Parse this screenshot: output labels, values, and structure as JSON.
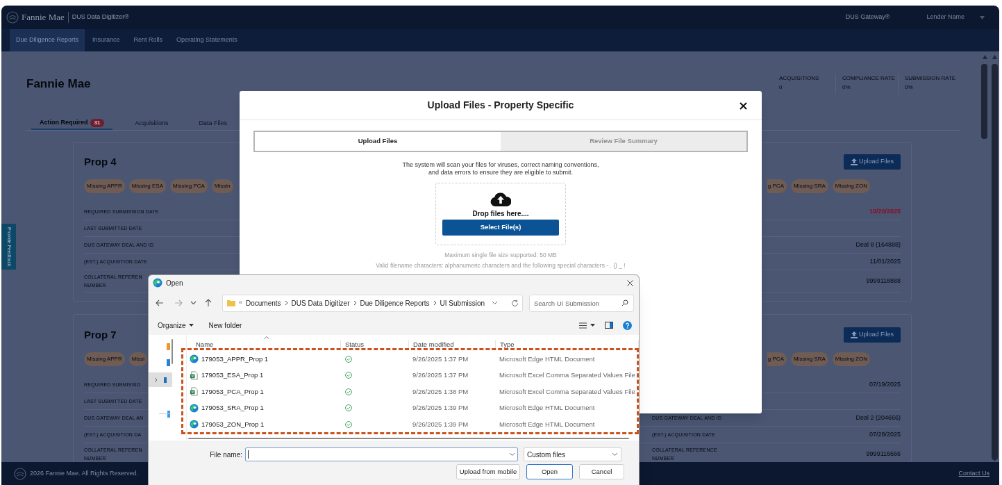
{
  "header": {
    "brand": "Fannie Mae",
    "app": "DUS Data Digitizer®",
    "gateway": "DUS Gateway®",
    "user": "Lender Name"
  },
  "nav_tabs": [
    {
      "label": "Due Diligence Reports",
      "selected": true
    },
    {
      "label": "Insurance",
      "selected": false
    },
    {
      "label": "Rent Rolls",
      "selected": false
    },
    {
      "label": "Operating Statements",
      "selected": false
    }
  ],
  "page_title": "Fannie Mae",
  "stats": [
    {
      "label": "ACQUISITIONS",
      "value": "0"
    },
    {
      "label": "COMPLIANCE RATE",
      "value": "0%"
    },
    {
      "label": "SUBMISSION RATE",
      "value": "0%"
    }
  ],
  "tabs": [
    {
      "label": "Action Required",
      "badge": "31",
      "selected": true
    },
    {
      "label": "Acquisitions",
      "selected": false
    },
    {
      "label": "Data Files",
      "selected": false
    }
  ],
  "feedback_tab": "Provide Feedback",
  "cards": [
    {
      "title": "Prop 4",
      "upload_button": "Upload Files",
      "tags": [
        "Missing APPR",
        "Missing ESA",
        "Missing PCA",
        "Missin"
      ],
      "tags_right": [
        "g PCA",
        "Missing SRA",
        "Missing ZON"
      ],
      "rows": [
        {
          "label": "REQUIRED SUBMISSION DATE",
          "value": "10/20/2025",
          "overdue": true
        },
        {
          "label": "LAST SUBMITTED DATE",
          "overdue": false
        },
        {
          "label": "DUS GATEWAY DEAL AND ID",
          "value": "Deal 8 (164888)",
          "overdue": false
        },
        {
          "label": "(EST.) ACQUISITION DATE",
          "value": "11/01/2025",
          "overdue": false
        },
        {
          "label": "COLLATERAL REFEREN\nNUMBER",
          "value": "9999118888",
          "overdue": false
        }
      ]
    },
    {
      "title": "Prop 7",
      "upload_button": "Upload Files",
      "tags": [
        "Missing APPR",
        "Missi"
      ],
      "tags_right": [
        "g PCA",
        "Missing SRA",
        "Missing ZON"
      ],
      "rows": [
        {
          "label": "REQUIRED SUBMISSIO",
          "value": "07/19/2025",
          "overdue": false
        },
        {
          "label": "LAST SUBMITTED DATE",
          "overdue": false
        },
        {
          "label": "DUS GATEWAY DEAL AN",
          "label_2": "DUS GATEWAY DEAL AND ID",
          "value": "Deal 2 (204666)",
          "overdue": false
        },
        {
          "label": "(EST.) ACQUISITION DA",
          "label_2": "(EST.) ACQUISITION DATE",
          "value": "07/28/2025",
          "overdue": false
        },
        {
          "label": "COLLATERAL REFEREN\nNUMBER",
          "label_2": "COLLATERAL REFERENCE\nNUMBER",
          "value": "9999116666",
          "overdue": false
        }
      ]
    }
  ],
  "footer": {
    "copyright": "2026 Fannie Mae. All Rights Reserved.",
    "link": "Contact Us"
  },
  "upload_modal": {
    "title": "Upload Files - Property Specific",
    "steps": [
      {
        "label": "Upload Files",
        "selected": true
      },
      {
        "label": "Review File Summary",
        "selected": false
      }
    ],
    "description": "The system will scan your files for viruses, correct naming conventions,\nand data errors to ensure they are eligible to submit.",
    "drop_text": "Drop files here....",
    "select_button": "Select File(s)",
    "limits": [
      "Maximum single file size supported: 50 MB",
      "Valid filename characters: alphanumeric characters and the following special characters - . () _ !"
    ]
  },
  "open_dialog": {
    "title": "Open",
    "overflow_mark": "«",
    "breadcrumb": [
      "Documents",
      "DUS Data Digitizer",
      "Due Diligence Reports",
      "UI Submission"
    ],
    "search_placeholder": "Search UI Submission",
    "toolbar": [
      "Organize",
      "New folder"
    ],
    "columns": [
      "Name",
      "Status",
      "Date modified",
      "Type"
    ],
    "files": [
      {
        "name": "179053_APPR_Prop 1",
        "kind": "edge",
        "synced": true,
        "date": "9/26/2025 1:37 PM",
        "type": "Microsoft Edge HTML Document"
      },
      {
        "name": "179053_ESA_Prop 1",
        "kind": "excel",
        "synced": true,
        "date": "9/26/2025 1:37 PM",
        "type": "Microsoft Excel Comma Separated Values File"
      },
      {
        "name": "179053_PCA_Prop 1",
        "kind": "excel",
        "synced": true,
        "date": "9/26/2025 1:38 PM",
        "type": "Microsoft Excel Comma Separated Values File"
      },
      {
        "name": "179053_SRA_Prop 1",
        "kind": "edge",
        "synced": true,
        "date": "9/26/2025 1:39 PM",
        "type": "Microsoft Edge HTML Document"
      },
      {
        "name": "179053_ZON_Prop 1",
        "kind": "edge",
        "synced": true,
        "date": "9/26/2025 1:39 PM",
        "type": "Microsoft Edge HTML Document"
      }
    ],
    "file_name_label": "File name:",
    "file_type": "Custom files",
    "buttons": [
      {
        "label": "Upload from mobile",
        "default": false
      },
      {
        "label": "Open",
        "default": true
      },
      {
        "label": "Cancel",
        "default": false
      }
    ]
  }
}
